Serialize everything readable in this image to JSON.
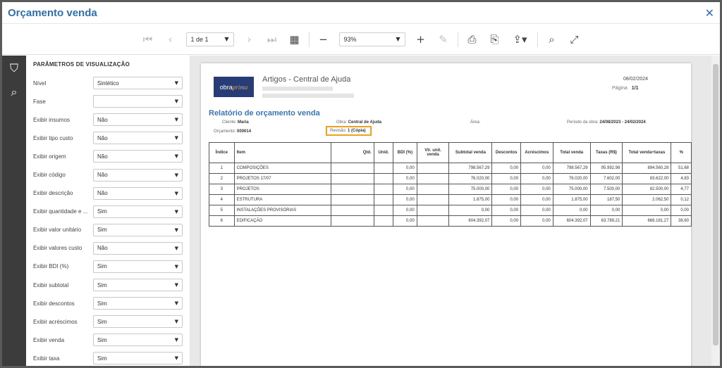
{
  "window": {
    "title": "Orçamento venda"
  },
  "toolbar": {
    "page_value": "1 de 1",
    "zoom_value": "93%"
  },
  "params": {
    "heading": "PARÂMETROS DE VISUALIZAÇÃO",
    "rows": [
      {
        "label": "Nível",
        "value": "Sintético"
      },
      {
        "label": "Fase",
        "value": ""
      },
      {
        "label": "Exibir insumos",
        "value": "Não"
      },
      {
        "label": "Exibir tipo custo",
        "value": "Não"
      },
      {
        "label": "Exibir origem",
        "value": "Não"
      },
      {
        "label": "Exibir código",
        "value": "Não"
      },
      {
        "label": "Exibir descrição",
        "value": "Não"
      },
      {
        "label": "Exibir quantidade e ...",
        "value": "Sim"
      },
      {
        "label": "Exibir valor unitário",
        "value": "Sim"
      },
      {
        "label": "Exibir valores custo",
        "value": "Não"
      },
      {
        "label": "Exibir BDI (%)",
        "value": "Sim"
      },
      {
        "label": "Exibir subtotal",
        "value": "Sim"
      },
      {
        "label": "Exibir descontos",
        "value": "Sim"
      },
      {
        "label": "Exibir acréscimos",
        "value": "Sim"
      },
      {
        "label": "Exibir venda",
        "value": "Sim"
      },
      {
        "label": "Exibir taxa",
        "value": "Sim"
      }
    ]
  },
  "report": {
    "logo_a": "obra",
    "logo_b": "prima",
    "company": "Artigos - Central de Ajuda",
    "date": "08/02/2024",
    "page_label": "Página",
    "page_value": "1/1",
    "title": "Relatório de orçamento venda",
    "cliente_label": "Cliente:",
    "cliente_value": "Maria",
    "obra_label": "Obra:",
    "obra_value": "Central de Ajuda",
    "area_label": "Área:",
    "periodo_label": "Período da obra:",
    "periodo_value": "24/08/2023 - 24/02/2024",
    "orcamento_label": "Orçamento:",
    "orcamento_value": "000014",
    "revisao_label": "Revisão:",
    "revisao_value": "1 (Cópia)",
    "headers": [
      "Índice",
      "Item",
      "Qtd.",
      "Unid.",
      "BDI (%)",
      "Vlr. unit. venda",
      "Subtotal venda",
      "Descontos",
      "Acréscimos",
      "Total venda",
      "Taxas (R$)",
      "Total venda+taxas",
      "%"
    ],
    "rows": [
      [
        "1",
        "COMPOSIÇÕES",
        "",
        "",
        "0,00",
        "",
        "798.567,29",
        "0,00",
        "0,00",
        "798.567,29",
        "95.992,98",
        "894.560,28",
        "51,68"
      ],
      [
        "2",
        "PROJETOS 17/07",
        "",
        "",
        "0,00",
        "",
        "76.020,00",
        "0,00",
        "0,00",
        "76.020,00",
        "7.602,00",
        "83.622,00",
        "4,83"
      ],
      [
        "3",
        "PROJETOS",
        "",
        "",
        "0,00",
        "",
        "75.000,00",
        "0,00",
        "0,00",
        "75.000,00",
        "7.500,00",
        "82.500,00",
        "4,77"
      ],
      [
        "4",
        "ESTRUTURA",
        "",
        "",
        "0,00",
        "",
        "1.875,00",
        "0,00",
        "0,00",
        "1.875,00",
        "187,50",
        "2.062,50",
        "0,12"
      ],
      [
        "5",
        "INSTALAÇÕES PROVISÓRIAS",
        "",
        "",
        "0,00",
        "",
        "0,00",
        "0,00",
        "0,00",
        "0,00",
        "0,00",
        "0,00",
        "0,00"
      ],
      [
        "6",
        "EDIFICAÇÃO",
        "",
        "",
        "0,00",
        "",
        "604.392,07",
        "0,00",
        "0,00",
        "604.392,07",
        "63.789,21",
        "668.181,27",
        "38,60"
      ]
    ]
  }
}
